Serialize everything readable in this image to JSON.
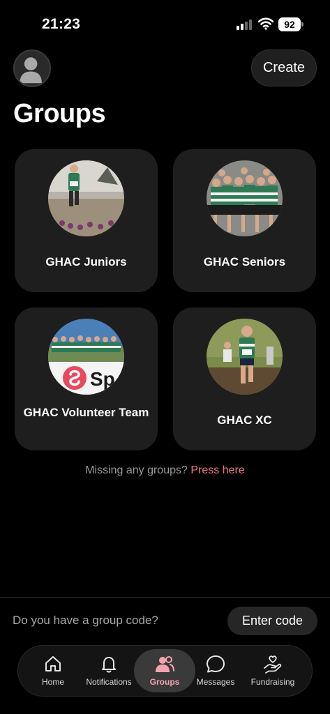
{
  "status_bar": {
    "time": "21:23",
    "battery": "92"
  },
  "header": {
    "create_label": "Create",
    "title": "Groups"
  },
  "groups": [
    {
      "name": "GHAC Juniors"
    },
    {
      "name": "GHAC Seniors"
    },
    {
      "name": "GHAC Volunteer Team"
    },
    {
      "name": "GHAC XC"
    }
  ],
  "missing": {
    "text": "Missing any groups?",
    "link": "Press here"
  },
  "group_code": {
    "question": "Do you have a group code?",
    "button": "Enter code"
  },
  "tabs": [
    {
      "label": "Home",
      "icon": "home-icon"
    },
    {
      "label": "Notifications",
      "icon": "bell-icon"
    },
    {
      "label": "Groups",
      "icon": "users-icon",
      "active": true
    },
    {
      "label": "Messages",
      "icon": "chat-bubble-icon"
    },
    {
      "label": "Fundraising",
      "icon": "hand-heart-icon"
    }
  ],
  "colors": {
    "accent": "#f0768b",
    "active_tab": "#f2a3b0",
    "card_bg": "#1e1e1e"
  }
}
